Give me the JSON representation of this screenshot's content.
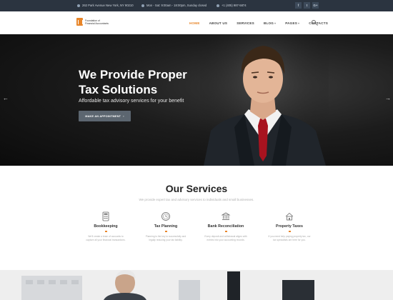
{
  "topbar": {
    "address": "262 Park Avenue New York, NY 90210",
    "hours": "Mon - Sat: 9:00am - 18:00pm, Sunday closed",
    "phone": "+1 (405) 987-5874",
    "social": [
      "f",
      "t",
      "G+"
    ]
  },
  "logo": {
    "text": "Foundation of Financial Accountants"
  },
  "nav": {
    "items": [
      "HOME",
      "ABOUT US",
      "SERVICES",
      "BLOG",
      "PAGES",
      "CONTACTS"
    ],
    "active": "HOME"
  },
  "hero": {
    "title_line1": "We Provide Proper",
    "title_line2": "Tax Solutions",
    "subtitle": "Affordable tax advisory services for your benefit",
    "button": "MAKE AN APPOINTMENT",
    "prev": "←",
    "next": "→"
  },
  "services": {
    "title": "Our Services",
    "subtitle": "We provide expert tax and advisory services to individuals and small businesses.",
    "items": [
      {
        "name": "Bookkeeping",
        "desc_line1": "We'll create a team of accounts to",
        "desc_line2": "capture all your financial transactions.",
        "icon": "calculator-icon"
      },
      {
        "name": "Tax Planning",
        "desc_line1": "Planning is the key to successfully and",
        "desc_line2": "legally reducing your tax liability.",
        "icon": "clock-money-icon"
      },
      {
        "name": "Bank Reconciliation",
        "desc_line1": "Every deposit and withdrawal aligns with",
        "desc_line2": "entries into your accounting records.",
        "icon": "bank-icon"
      },
      {
        "name": "Property Taxes",
        "desc_line1": "If you need help paying property tax, our",
        "desc_line2": "tax specialists are here for you.",
        "icon": "house-icon"
      }
    ]
  },
  "colors": {
    "accent": "#e8862a",
    "topbar": "#2b3440",
    "button": "#5c6670"
  }
}
